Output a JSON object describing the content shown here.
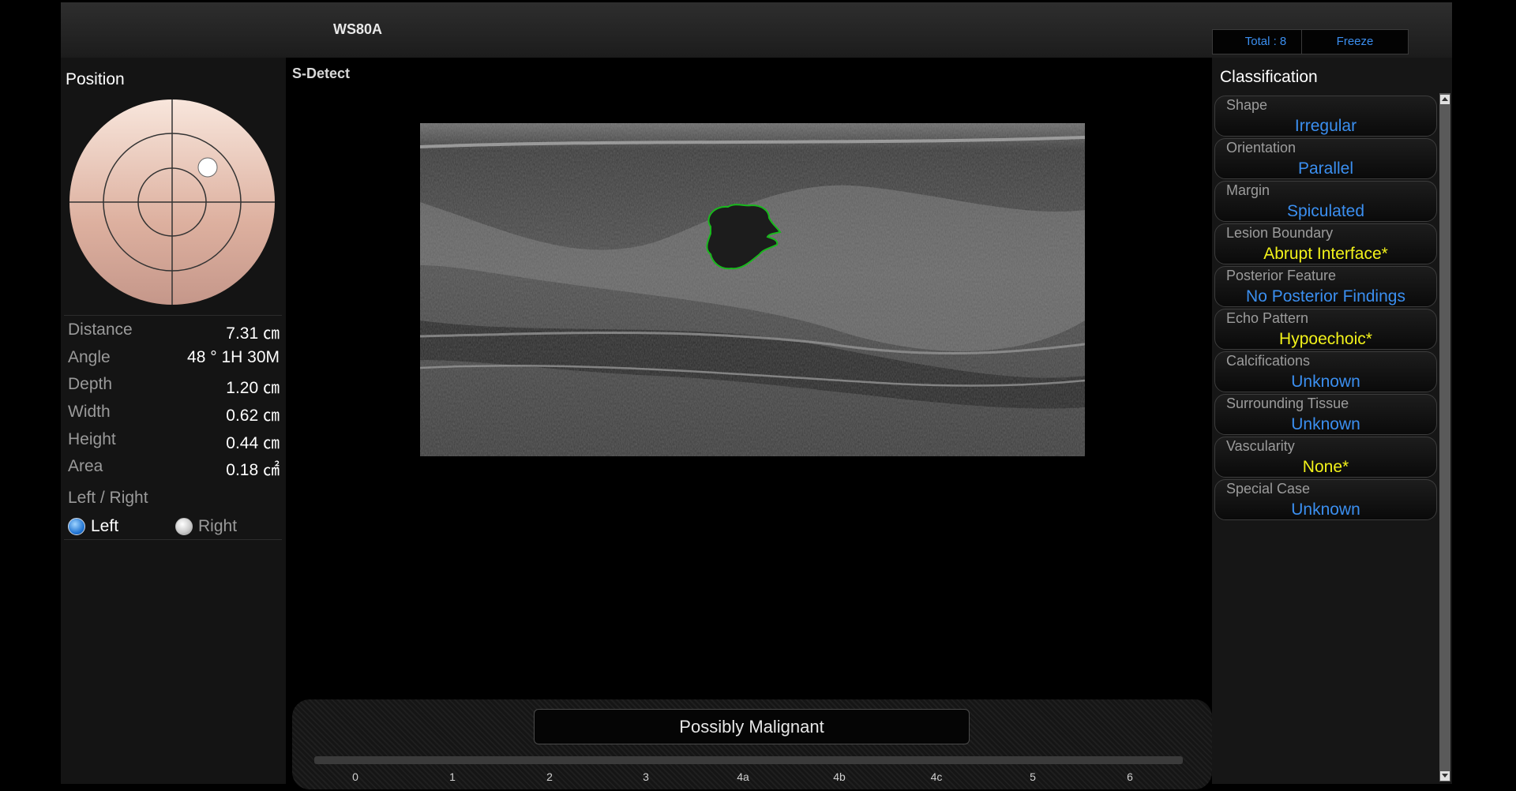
{
  "header": {
    "device_name": "WS80A",
    "total_label": "Total : 8",
    "freeze_label": "Freeze"
  },
  "left": {
    "position_title": "Position",
    "measurements": [
      {
        "label": "Distance",
        "value": "7.31 ㎝"
      },
      {
        "label": "Angle",
        "value": "48 ° 1H 30M"
      },
      {
        "label": "Depth",
        "value": "1.20 ㎝"
      },
      {
        "label": "Width",
        "value": "0.62 ㎝"
      },
      {
        "label": "Height",
        "value": "0.44 ㎝"
      },
      {
        "label": "Area",
        "value": "0.18 ㎠"
      }
    ],
    "lr_title": "Left / Right",
    "radio_left": "Left",
    "radio_right": "Right",
    "selected_side": "Left"
  },
  "center": {
    "sdetect_label": "S-Detect",
    "result": "Possibly Malignant",
    "scale_ticks": [
      "0",
      "1",
      "2",
      "3",
      "4a",
      "4b",
      "4c",
      "5",
      "6"
    ]
  },
  "right": {
    "title": "Classification",
    "items": [
      {
        "name": "Shape",
        "value": "Irregular",
        "color": "#3b8ff0"
      },
      {
        "name": "Orientation",
        "value": "Parallel",
        "color": "#3b8ff0"
      },
      {
        "name": "Margin",
        "value": "Spiculated",
        "color": "#3b8ff0"
      },
      {
        "name": "Lesion Boundary",
        "value": "Abrupt Interface*",
        "color": "#f2f21a"
      },
      {
        "name": "Posterior Feature",
        "value": "No Posterior Findings",
        "color": "#3b8ff0"
      },
      {
        "name": "Echo Pattern",
        "value": "Hypoechoic*",
        "color": "#f2f21a"
      },
      {
        "name": "Calcifications",
        "value": "Unknown",
        "color": "#3b8ff0"
      },
      {
        "name": "Surrounding Tissue",
        "value": "Unknown",
        "color": "#3b8ff0"
      },
      {
        "name": "Vascularity",
        "value": "None*",
        "color": "#f2f21a"
      },
      {
        "name": "Special Case",
        "value": "Unknown",
        "color": "#3b8ff0"
      }
    ]
  },
  "colors": {
    "accent_blue": "#3b8ff0",
    "highlight_yellow": "#f2f21a",
    "lesion_outline": "#19b81d"
  }
}
